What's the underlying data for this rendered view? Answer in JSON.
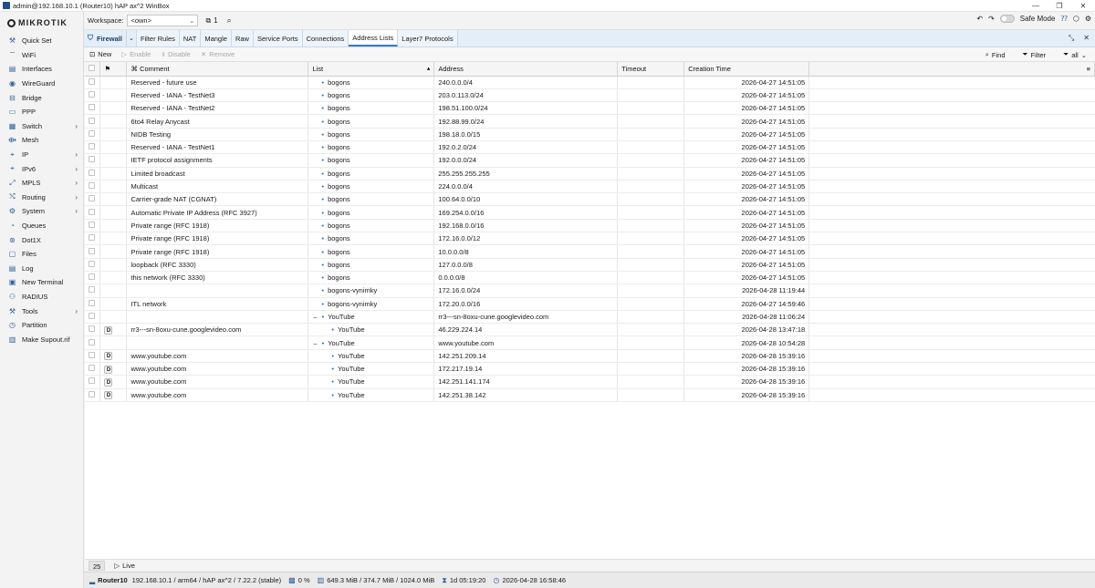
{
  "window": {
    "title": "admin@192.168.10.1 (Router10) hAP ax^2 WinBox",
    "controls": [
      "—",
      "❐",
      "✕"
    ]
  },
  "sidebar": {
    "logo": "MikroTik",
    "items": [
      {
        "label": "Quick Set",
        "icon": "quick-set-icon",
        "glyph": "⚒",
        "submenu": false
      },
      {
        "label": "WiFi",
        "icon": "wifi-icon",
        "glyph": "⌔",
        "submenu": false
      },
      {
        "label": "Interfaces",
        "icon": "interfaces-icon",
        "glyph": "▤",
        "submenu": false
      },
      {
        "label": "WireGuard",
        "icon": "wireguard-icon",
        "glyph": "◉",
        "submenu": false
      },
      {
        "label": "Bridge",
        "icon": "bridge-icon",
        "glyph": "⊟",
        "submenu": false
      },
      {
        "label": "PPP",
        "icon": "ppp-icon",
        "glyph": "▭",
        "submenu": false
      },
      {
        "label": "Switch",
        "icon": "switch-icon",
        "glyph": "▦",
        "submenu": true
      },
      {
        "label": "Mesh",
        "icon": "mesh-icon",
        "glyph": "⟴",
        "submenu": false
      },
      {
        "label": "IP",
        "icon": "ip-icon",
        "glyph": "⌖",
        "submenu": true
      },
      {
        "label": "IPv6",
        "icon": "ipv6-icon",
        "glyph": "⌖",
        "submenu": true
      },
      {
        "label": "MPLS",
        "icon": "mpls-icon",
        "glyph": "⤢",
        "submenu": true
      },
      {
        "label": "Routing",
        "icon": "routing-icon",
        "glyph": "⤭",
        "submenu": true
      },
      {
        "label": "System",
        "icon": "system-icon",
        "glyph": "⚙",
        "submenu": true
      },
      {
        "label": "Queues",
        "icon": "queues-icon",
        "glyph": "◔",
        "submenu": false
      },
      {
        "label": "Dot1X",
        "icon": "dot1x-icon",
        "glyph": "⊛",
        "submenu": false
      },
      {
        "label": "Files",
        "icon": "files-icon",
        "glyph": "▢",
        "submenu": false
      },
      {
        "label": "Log",
        "icon": "log-icon",
        "glyph": "▤",
        "submenu": false
      },
      {
        "label": "New Terminal",
        "icon": "terminal-icon",
        "glyph": "▣",
        "submenu": false
      },
      {
        "label": "RADIUS",
        "icon": "radius-icon",
        "glyph": "⚇",
        "submenu": false
      },
      {
        "label": "Tools",
        "icon": "tools-icon",
        "glyph": "⚒",
        "submenu": true
      },
      {
        "label": "Partition",
        "icon": "partition-icon",
        "glyph": "◷",
        "submenu": false
      },
      {
        "label": "Make Supout.rif",
        "icon": "supout-icon",
        "glyph": "▥",
        "submenu": false
      }
    ]
  },
  "topbar": {
    "workspace_label": "Workspace:",
    "workspace_value": "<own>",
    "window_count": "1",
    "safe_mode_label": "Safe Mode"
  },
  "tabs": {
    "main": "Firewall",
    "items": [
      "Filter Rules",
      "NAT",
      "Mangle",
      "Raw",
      "Service Ports",
      "Connections",
      "Address Lists",
      "Layer7 Protocols"
    ],
    "active_index": 6
  },
  "toolbar": {
    "new": "New",
    "enable": "Enable",
    "disable": "Disable",
    "remove": "Remove",
    "find": "Find",
    "filter": "Filter",
    "filter_value": "all"
  },
  "table": {
    "headers": {
      "comment": "Comment",
      "list": "List",
      "address": "Address",
      "timeout": "Timeout",
      "creation_time": "Creation Time"
    },
    "rows": [
      {
        "flag": "",
        "comment": "Reserved - future use",
        "list": "bogons",
        "level": 0,
        "address": "240.0.0.0/4",
        "timeout": "",
        "time": "2026-04-27 14:51:05"
      },
      {
        "flag": "",
        "comment": "Reserved - IANA - TestNet3",
        "list": "bogons",
        "level": 0,
        "address": "203.0.113.0/24",
        "timeout": "",
        "time": "2026-04-27 14:51:05"
      },
      {
        "flag": "",
        "comment": "Reserved - IANA - TestNet2",
        "list": "bogons",
        "level": 0,
        "address": "198.51.100.0/24",
        "timeout": "",
        "time": "2026-04-27 14:51:05"
      },
      {
        "flag": "",
        "comment": "6to4 Relay Anycast",
        "list": "bogons",
        "level": 0,
        "address": "192.88.99.0/24",
        "timeout": "",
        "time": "2026-04-27 14:51:05"
      },
      {
        "flag": "",
        "comment": "NIDB Testing",
        "list": "bogons",
        "level": 0,
        "address": "198.18.0.0/15",
        "timeout": "",
        "time": "2026-04-27 14:51:05"
      },
      {
        "flag": "",
        "comment": "Reserved - IANA - TestNet1",
        "list": "bogons",
        "level": 0,
        "address": "192.0.2.0/24",
        "timeout": "",
        "time": "2026-04-27 14:51:05"
      },
      {
        "flag": "",
        "comment": "IETF protocol assignments",
        "list": "bogons",
        "level": 0,
        "address": "192.0.0.0/24",
        "timeout": "",
        "time": "2026-04-27 14:51:05"
      },
      {
        "flag": "",
        "comment": "Limited broadcast",
        "list": "bogons",
        "level": 0,
        "address": "255.255.255.255",
        "timeout": "",
        "time": "2026-04-27 14:51:05"
      },
      {
        "flag": "",
        "comment": "Multicast",
        "list": "bogons",
        "level": 0,
        "address": "224.0.0.0/4",
        "timeout": "",
        "time": "2026-04-27 14:51:05"
      },
      {
        "flag": "",
        "comment": "Carrier-grade NAT (CGNAT)",
        "list": "bogons",
        "level": 0,
        "address": "100.64.0.0/10",
        "timeout": "",
        "time": "2026-04-27 14:51:05"
      },
      {
        "flag": "",
        "comment": "Automatic Private IP Address (RFC 3927)",
        "list": "bogons",
        "level": 0,
        "address": "169.254.0.0/16",
        "timeout": "",
        "time": "2026-04-27 14:51:05"
      },
      {
        "flag": "",
        "comment": "Private range (RFC 1918)",
        "list": "bogons",
        "level": 0,
        "address": "192.168.0.0/16",
        "timeout": "",
        "time": "2026-04-27 14:51:05"
      },
      {
        "flag": "",
        "comment": "Private range (RFC 1918)",
        "list": "bogons",
        "level": 0,
        "address": "172.16.0.0/12",
        "timeout": "",
        "time": "2026-04-27 14:51:05"
      },
      {
        "flag": "",
        "comment": "Private range (RFC 1918)",
        "list": "bogons",
        "level": 0,
        "address": "10.0.0.0/8",
        "timeout": "",
        "time": "2026-04-27 14:51:05"
      },
      {
        "flag": "",
        "comment": "loopback (RFC 3330)",
        "list": "bogons",
        "level": 0,
        "address": "127.0.0.0/8",
        "timeout": "",
        "time": "2026-04-27 14:51:05"
      },
      {
        "flag": "",
        "comment": "this network (RFC 3330)",
        "list": "bogons",
        "level": 0,
        "address": "0.0.0.0/8",
        "timeout": "",
        "time": "2026-04-27 14:51:05"
      },
      {
        "flag": "",
        "comment": "",
        "list": "bogons-vynimky",
        "level": 0,
        "address": "172.16.0.0/24",
        "timeout": "",
        "time": "2026-04-28 11:19:44"
      },
      {
        "flag": "",
        "comment": "ITL network",
        "list": "bogons-vynimky",
        "level": 0,
        "address": "172.20.0.0/16",
        "timeout": "",
        "time": "2026-04-27 14:59:46"
      },
      {
        "flag": "",
        "comment": "",
        "list": "YouTube",
        "level": -1,
        "address": "rr3---sn-8oxu-cune.googlevideo.com",
        "timeout": "",
        "time": "2026-04-28 11:06:24"
      },
      {
        "flag": "D",
        "comment": "rr3---sn-8oxu-cune.googlevideo.com",
        "list": "YouTube",
        "level": 1,
        "address": "46.229.224.14",
        "timeout": "",
        "time": "2026-04-28 13:47:18"
      },
      {
        "flag": "",
        "comment": "",
        "list": "YouTube",
        "level": -1,
        "address": "www.youtube.com",
        "timeout": "",
        "time": "2026-04-28 10:54:28"
      },
      {
        "flag": "D",
        "comment": "www.youtube.com",
        "list": "YouTube",
        "level": 1,
        "address": "142.251.209.14",
        "timeout": "",
        "time": "2026-04-28 15:39:16"
      },
      {
        "flag": "D",
        "comment": "www.youtube.com",
        "list": "YouTube",
        "level": 1,
        "address": "172.217.19.14",
        "timeout": "",
        "time": "2026-04-28 15:39:16"
      },
      {
        "flag": "D",
        "comment": "www.youtube.com",
        "list": "YouTube",
        "level": 1,
        "address": "142.251.141.174",
        "timeout": "",
        "time": "2026-04-28 15:39:16"
      },
      {
        "flag": "D",
        "comment": "www.youtube.com",
        "list": "YouTube",
        "level": 1,
        "address": "142.251.38.142",
        "timeout": "",
        "time": "2026-04-28 15:39:16"
      }
    ]
  },
  "footer": {
    "count": "25",
    "live": "Live"
  },
  "status": {
    "router": "Router10",
    "info": "192.168.10.1 / arm64 / hAP ax^2 / 7.22.2 (stable)",
    "cpu": "0 %",
    "memory": "649.3 MiB / 374.7 MiB / 1024.0 MiB",
    "uptime": "1d 05:19:20",
    "clock": "2026-04-28 16:58:46"
  },
  "colors": {
    "accent": "#3a78c8",
    "tabbar": "#e3eef9",
    "list_dot": "#2d6fc4"
  }
}
